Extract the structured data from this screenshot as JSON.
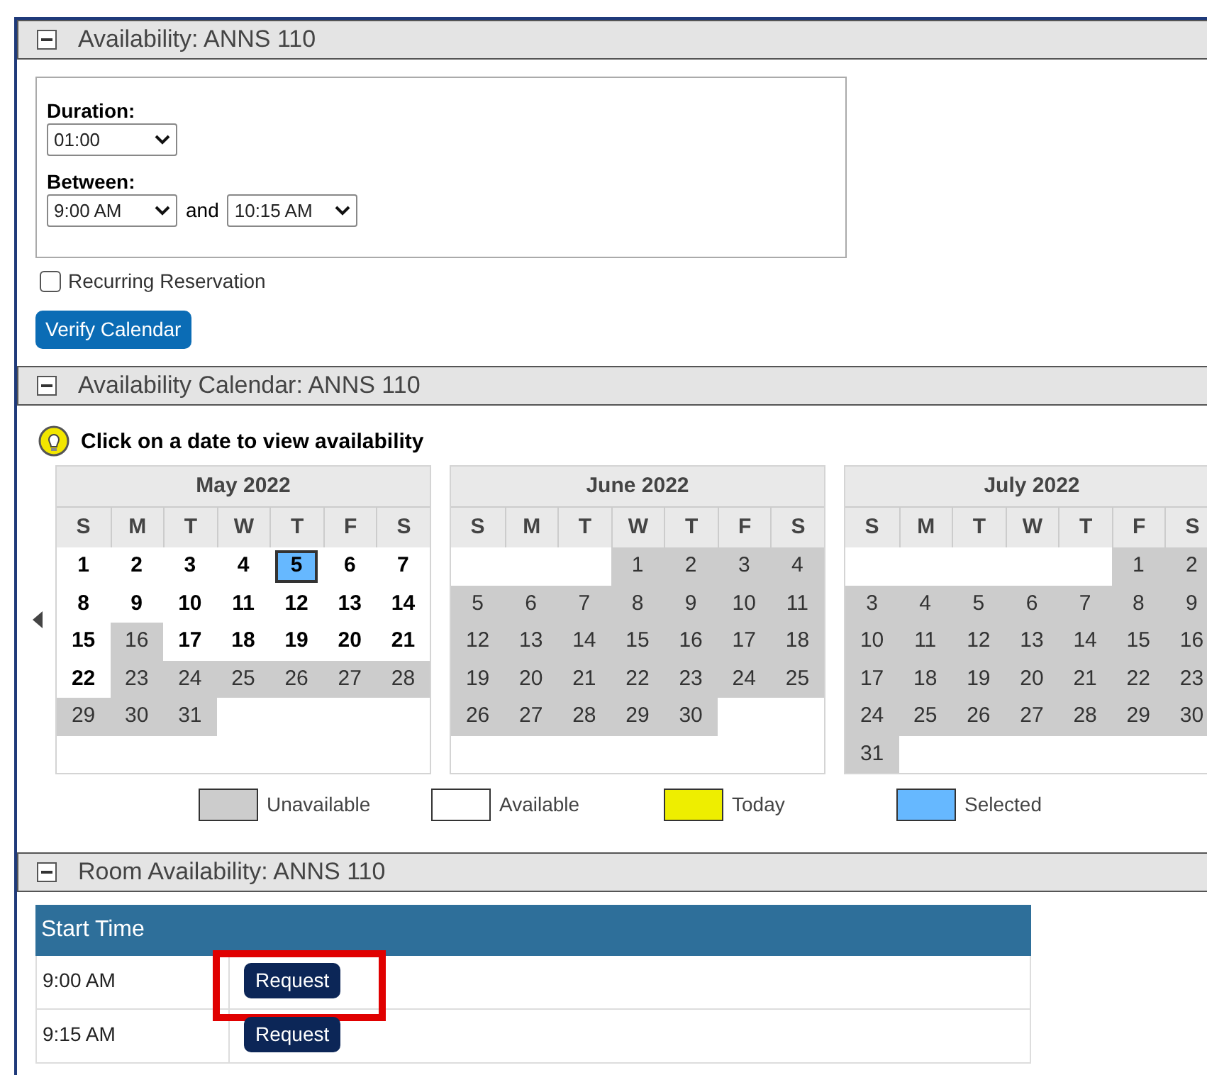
{
  "availability": {
    "title": "Availability: ANNS 110",
    "duration_label": "Duration:",
    "duration": "01:00",
    "between_label": "Between:",
    "start": "9:00 AM",
    "and_label": "and",
    "end": "10:15 AM",
    "recurring": {
      "label": "Recurring Reservation",
      "checked": false
    },
    "verify_button": "Verify Calendar"
  },
  "calendar": {
    "title": "Availability Calendar: ANNS 110",
    "hint": "Click on a date to view availability",
    "months": [
      {
        "name": "May 2022",
        "weekdays": [
          "S",
          "M",
          "T",
          "W",
          "T",
          "F",
          "S"
        ],
        "weeks": [
          [
            {
              "day": "1",
              "kind": "available"
            },
            {
              "day": "2",
              "kind": "available"
            },
            {
              "day": "3",
              "kind": "available"
            },
            {
              "day": "4",
              "kind": "available"
            },
            {
              "day": "5",
              "kind": "selected"
            },
            {
              "day": "6",
              "kind": "available"
            },
            {
              "day": "7",
              "kind": "available"
            }
          ],
          [
            {
              "day": "8",
              "kind": "available"
            },
            {
              "day": "9",
              "kind": "available"
            },
            {
              "day": "10",
              "kind": "available"
            },
            {
              "day": "11",
              "kind": "available"
            },
            {
              "day": "12",
              "kind": "available"
            },
            {
              "day": "13",
              "kind": "available"
            },
            {
              "day": "14",
              "kind": "available"
            }
          ],
          [
            {
              "day": "15",
              "kind": "available"
            },
            {
              "day": "16",
              "kind": "unavailable"
            },
            {
              "day": "17",
              "kind": "available"
            },
            {
              "day": "18",
              "kind": "available"
            },
            {
              "day": "19",
              "kind": "available"
            },
            {
              "day": "20",
              "kind": "available"
            },
            {
              "day": "21",
              "kind": "available"
            }
          ],
          [
            {
              "day": "22",
              "kind": "available"
            },
            {
              "day": "23",
              "kind": "unavailable"
            },
            {
              "day": "24",
              "kind": "unavailable"
            },
            {
              "day": "25",
              "kind": "unavailable"
            },
            {
              "day": "26",
              "kind": "unavailable"
            },
            {
              "day": "27",
              "kind": "unavailable"
            },
            {
              "day": "28",
              "kind": "unavailable"
            }
          ],
          [
            {
              "day": "29",
              "kind": "unavailable"
            },
            {
              "day": "30",
              "kind": "unavailable"
            },
            {
              "day": "31",
              "kind": "unavailable"
            }
          ]
        ]
      },
      {
        "name": "June 2022",
        "weekdays": [
          "S",
          "M",
          "T",
          "W",
          "T",
          "F",
          "S"
        ],
        "weeks": [
          {
            "kind": "right-aligned",
            "days": [
              {
                "day": "1",
                "kind": "unavailable"
              },
              {
                "day": "2",
                "kind": "unavailable"
              },
              {
                "day": "3",
                "kind": "unavailable"
              },
              {
                "day": "4",
                "kind": "unavailable"
              }
            ]
          },
          [
            {
              "day": "5",
              "kind": "unavailable"
            },
            {
              "day": "6",
              "kind": "unavailable"
            },
            {
              "day": "7",
              "kind": "unavailable"
            },
            {
              "day": "8",
              "kind": "unavailable"
            },
            {
              "day": "9",
              "kind": "unavailable"
            },
            {
              "day": "10",
              "kind": "unavailable"
            },
            {
              "day": "11",
              "kind": "unavailable"
            }
          ],
          [
            {
              "day": "12",
              "kind": "unavailable"
            },
            {
              "day": "13",
              "kind": "unavailable"
            },
            {
              "day": "14",
              "kind": "unavailable"
            },
            {
              "day": "15",
              "kind": "unavailable"
            },
            {
              "day": "16",
              "kind": "unavailable"
            },
            {
              "day": "17",
              "kind": "unavailable"
            },
            {
              "day": "18",
              "kind": "unavailable"
            }
          ],
          [
            {
              "day": "19",
              "kind": "unavailable"
            },
            {
              "day": "20",
              "kind": "unavailable"
            },
            {
              "day": "21",
              "kind": "unavailable"
            },
            {
              "day": "22",
              "kind": "unavailable"
            },
            {
              "day": "23",
              "kind": "unavailable"
            },
            {
              "day": "24",
              "kind": "unavailable"
            },
            {
              "day": "25",
              "kind": "unavailable"
            }
          ],
          [
            {
              "day": "26",
              "kind": "unavailable"
            },
            {
              "day": "27",
              "kind": "unavailable"
            },
            {
              "day": "28",
              "kind": "unavailable"
            },
            {
              "day": "29",
              "kind": "unavailable"
            },
            {
              "day": "30",
              "kind": "unavailable"
            }
          ]
        ]
      },
      {
        "name": "July 2022",
        "weekdays": [
          "S",
          "M",
          "T",
          "W",
          "T",
          "F",
          "S"
        ],
        "weeks": [
          {
            "kind": "right-aligned",
            "days": [
              {
                "day": "1",
                "kind": "unavailable"
              },
              {
                "day": "2",
                "kind": "unavailable"
              }
            ]
          },
          [
            {
              "day": "3",
              "kind": "unavailable"
            },
            {
              "day": "4",
              "kind": "unavailable"
            },
            {
              "day": "5",
              "kind": "unavailable"
            },
            {
              "day": "6",
              "kind": "unavailable"
            },
            {
              "day": "7",
              "kind": "unavailable"
            },
            {
              "day": "8",
              "kind": "unavailable"
            },
            {
              "day": "9",
              "kind": "unavailable"
            }
          ],
          [
            {
              "day": "10",
              "kind": "unavailable"
            },
            {
              "day": "11",
              "kind": "unavailable"
            },
            {
              "day": "12",
              "kind": "unavailable"
            },
            {
              "day": "13",
              "kind": "unavailable"
            },
            {
              "day": "14",
              "kind": "unavailable"
            },
            {
              "day": "15",
              "kind": "unavailable"
            },
            {
              "day": "16",
              "kind": "unavailable"
            }
          ],
          [
            {
              "day": "17",
              "kind": "unavailable"
            },
            {
              "day": "18",
              "kind": "unavailable"
            },
            {
              "day": "19",
              "kind": "unavailable"
            },
            {
              "day": "20",
              "kind": "unavailable"
            },
            {
              "day": "21",
              "kind": "unavailable"
            },
            {
              "day": "22",
              "kind": "unavailable"
            },
            {
              "day": "23",
              "kind": "unavailable"
            }
          ],
          [
            {
              "day": "24",
              "kind": "unavailable"
            },
            {
              "day": "25",
              "kind": "unavailable"
            },
            {
              "day": "26",
              "kind": "unavailable"
            },
            {
              "day": "27",
              "kind": "unavailable"
            },
            {
              "day": "28",
              "kind": "unavailable"
            },
            {
              "day": "29",
              "kind": "unavailable"
            },
            {
              "day": "30",
              "kind": "unavailable"
            }
          ],
          [
            {
              "day": "31",
              "kind": "unavailable"
            }
          ]
        ]
      }
    ],
    "legend": [
      {
        "label": "Unavailable",
        "color": "#cccccc"
      },
      {
        "label": "Available",
        "color": "#ffffff"
      },
      {
        "label": "Today",
        "color": "#eeee00"
      },
      {
        "label": "Selected",
        "color": "#66b8ff"
      }
    ]
  },
  "room": {
    "title": "Room Availability: ANNS 110",
    "columns": [
      "Start Time"
    ],
    "rows": [
      {
        "time": "9:00 AM",
        "button": "Request",
        "highlighted": true
      },
      {
        "time": "9:15 AM",
        "button": "Request",
        "highlighted": false
      }
    ]
  }
}
